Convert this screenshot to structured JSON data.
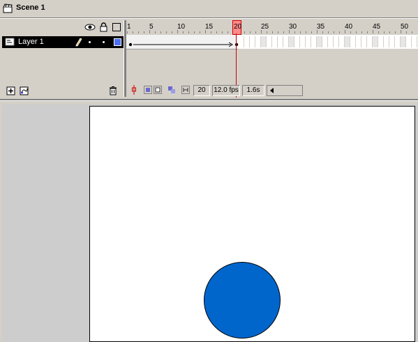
{
  "scene": {
    "label": "Scene 1",
    "icon": "clapperboard-icon"
  },
  "layer_header": {
    "icons": [
      "eye-icon",
      "lock-icon",
      "outline-icon"
    ]
  },
  "layers": [
    {
      "label": "Layer 1",
      "selected": true,
      "outline_color": "#4b6ff5"
    }
  ],
  "ruler": {
    "labels": [
      "1",
      "5",
      "10",
      "15",
      "20",
      "25",
      "30",
      "35",
      "40",
      "45",
      "50"
    ]
  },
  "playhead": {
    "frame": 20
  },
  "status": {
    "current_frame": "20",
    "fps": "12.0 fps",
    "elapsed": "1.6s"
  },
  "stage": {
    "shape": "circle",
    "fill_color": "#0066cc"
  },
  "colors": {
    "chrome": "#d4d0c8",
    "playhead": "#cc0000",
    "selection": "#000000"
  }
}
